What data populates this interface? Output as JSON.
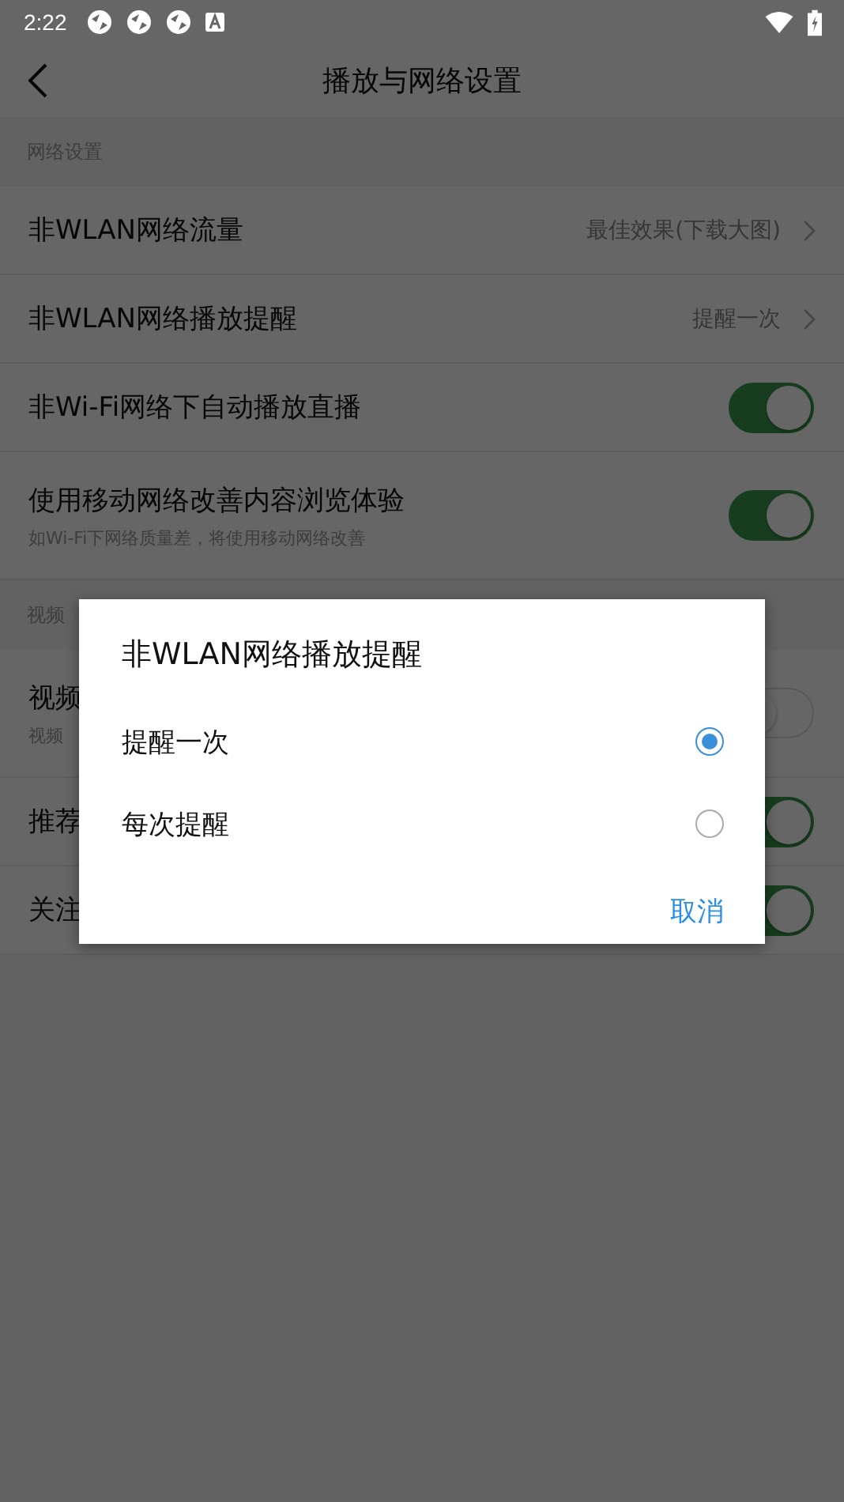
{
  "status_bar": {
    "time": "2:22"
  },
  "header": {
    "title": "播放与网络设置"
  },
  "sections": [
    {
      "title": "网络设置",
      "rows": [
        {
          "kind": "link",
          "title": "非WLAN网络流量",
          "value": "最佳效果(下载大图)"
        },
        {
          "kind": "link",
          "title": "非WLAN网络播放提醒",
          "value": "提醒一次"
        },
        {
          "kind": "toggle",
          "title": "非Wi-Fi网络下自动播放直播",
          "on": true
        },
        {
          "kind": "toggle",
          "title": "使用移动网络改善内容浏览体验",
          "subtitle": "如Wi-Fi下网络质量差，将使用移动网络改善",
          "on": true
        }
      ]
    },
    {
      "title": "视频",
      "rows": [
        {
          "kind": "toggle",
          "title": "视频",
          "subtitle": "视频",
          "on": false
        },
        {
          "kind": "toggle",
          "title": "推荐",
          "on": true
        },
        {
          "kind": "toggle",
          "title": "关注",
          "on": true
        }
      ]
    }
  ],
  "dialog": {
    "title": "非WLAN网络播放提醒",
    "options": [
      {
        "label": "提醒一次",
        "selected": true
      },
      {
        "label": "每次提醒",
        "selected": false
      }
    ],
    "buttons": [
      "取消"
    ]
  }
}
